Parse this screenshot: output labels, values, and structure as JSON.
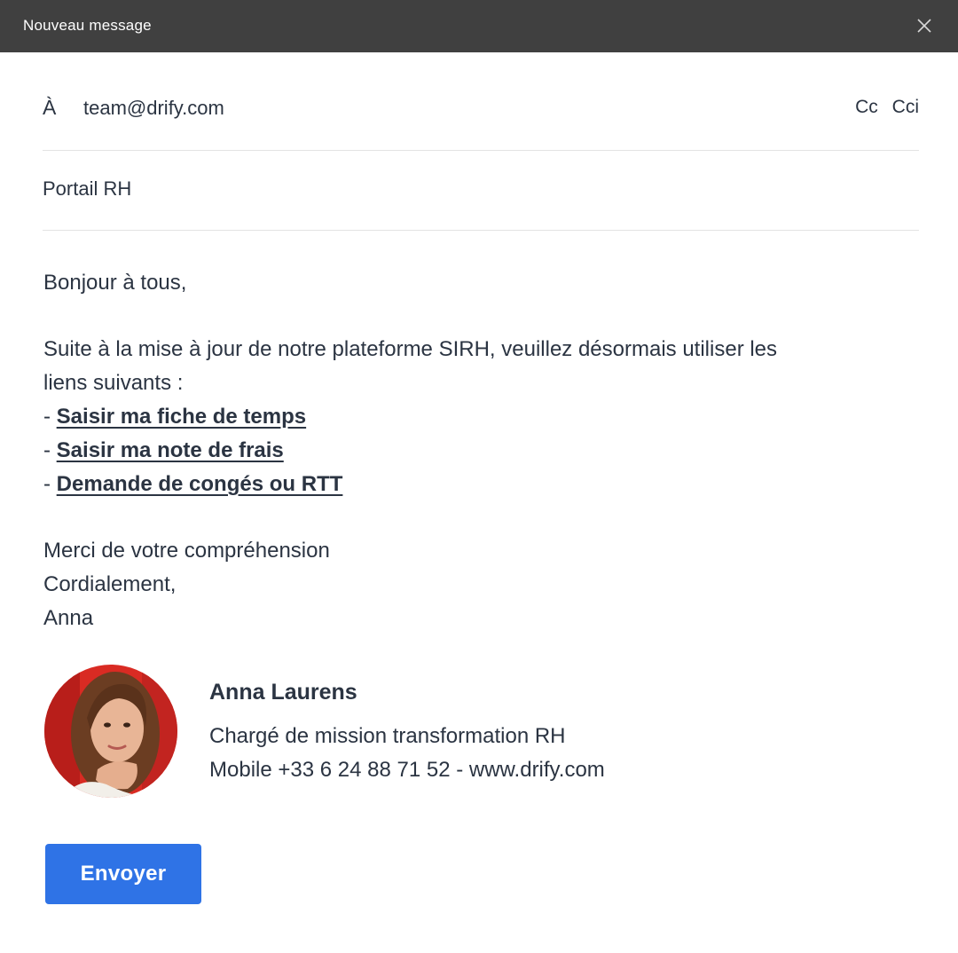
{
  "window": {
    "title": "Nouveau message",
    "close_icon": "close-icon"
  },
  "compose": {
    "to_label": "À",
    "to_value": "team@drify.com",
    "cc_label": "Cc",
    "bcc_label": "Cci",
    "subject": "Portail RH"
  },
  "body": {
    "greeting": "Bonjour à tous,",
    "intro_line1": "Suite à la mise à jour de notre plateforme SIRH, veuillez désormais utiliser les",
    "intro_line2": "liens suivants :",
    "bullet_prefix": "- ",
    "links": [
      "Saisir ma fiche de temps",
      "Saisir ma note de frais",
      "Demande de congés ou RTT"
    ],
    "closing1": "Merci de votre compréhension",
    "closing2": "Cordialement,",
    "closing3": "Anna"
  },
  "signature": {
    "name": "Anna Laurens",
    "role": "Chargé de mission transformation RH",
    "contact": "Mobile +33 6 24 88 71 52 - www.drify.com",
    "avatar_colors": {
      "background": "#d92b23",
      "hair": "#6b3d22",
      "skin": "#e8b596"
    }
  },
  "actions": {
    "send_label": "Envoyer",
    "send_color": "#2f73e6"
  }
}
